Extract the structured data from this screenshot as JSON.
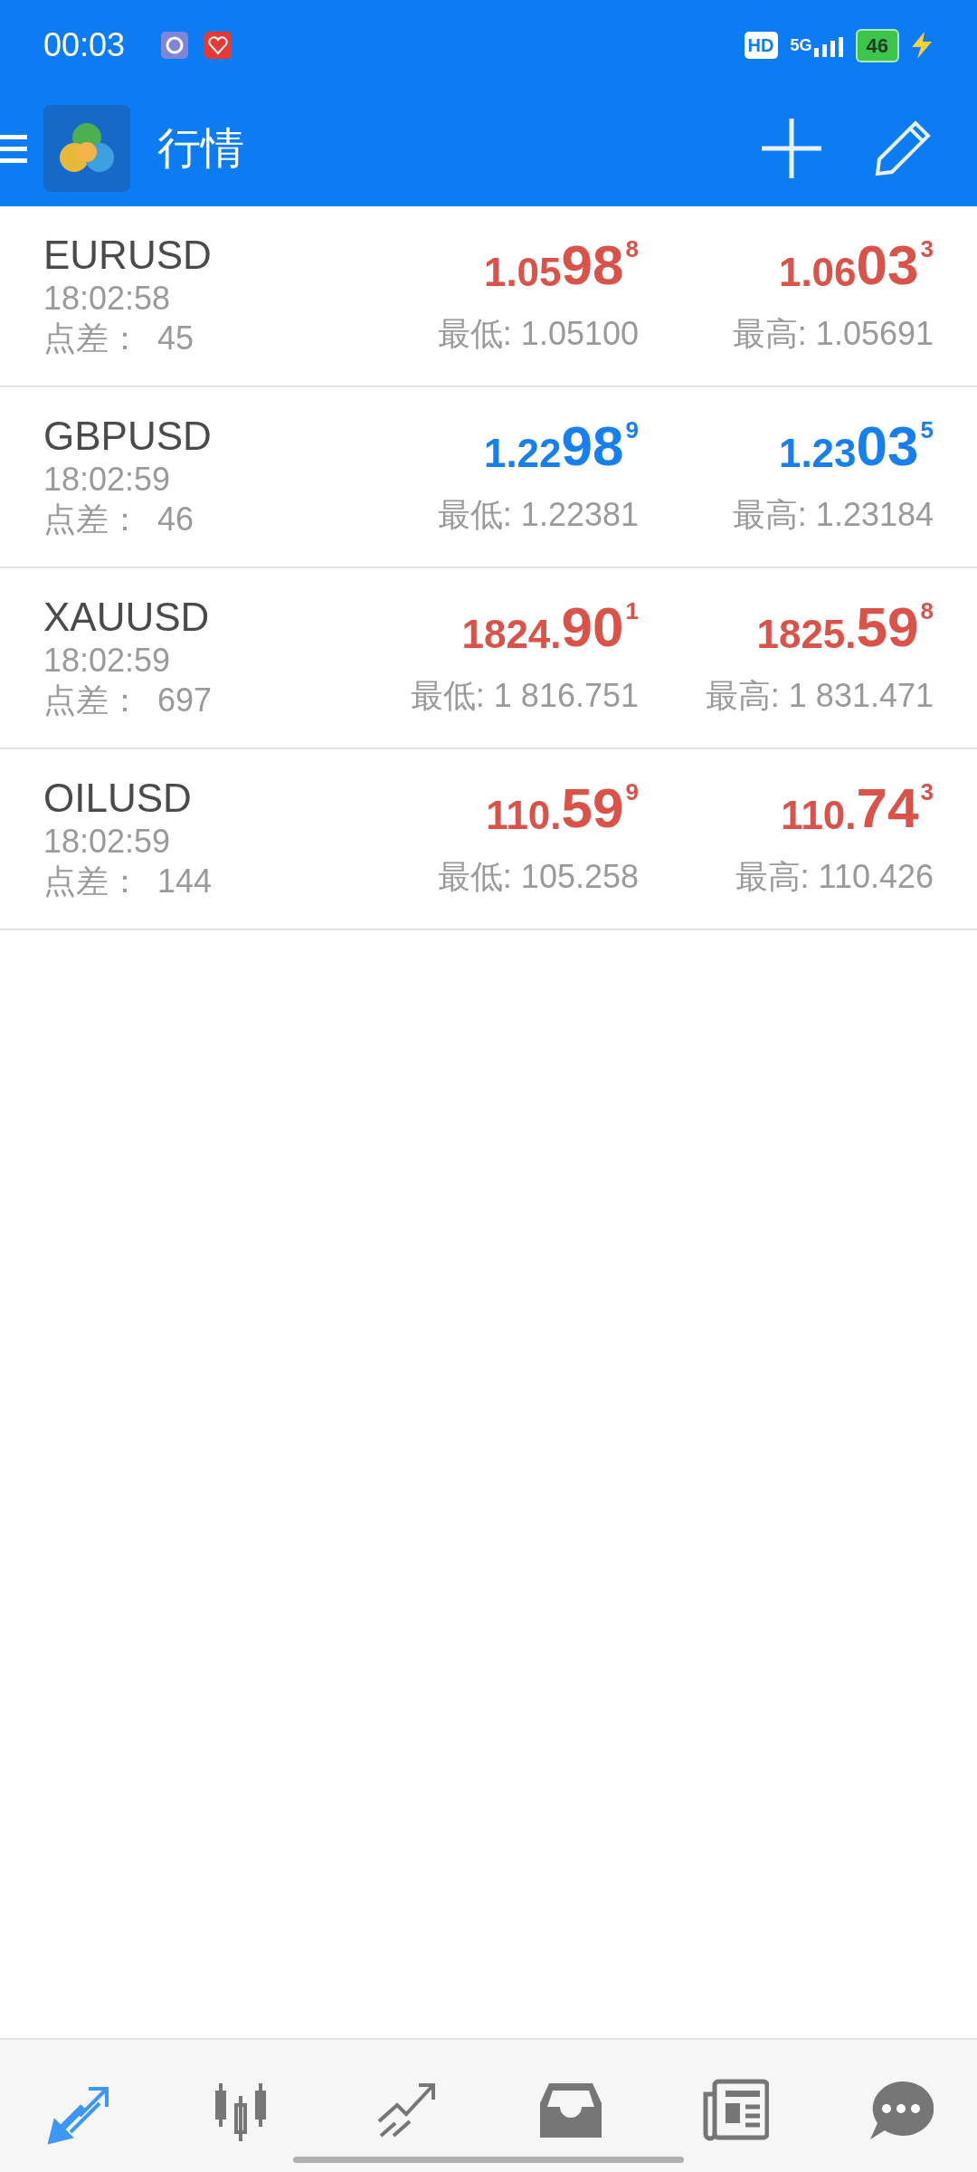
{
  "status_bar": {
    "time": "00:03",
    "hd": "HD",
    "network": "5G",
    "battery": "46"
  },
  "header": {
    "title": "行情"
  },
  "quotes": [
    {
      "symbol": "EURUSD",
      "time": "18:02:58",
      "spread_label": "点差：",
      "spread": "45",
      "bid": {
        "prefix": "1.05",
        "big": "98",
        "sup": "8",
        "color": "#d9534a"
      },
      "ask": {
        "prefix": "1.06",
        "big": "03",
        "sup": "3",
        "color": "#d9534a"
      },
      "low": "最低: 1.05100",
      "high": "最高: 1.05691"
    },
    {
      "symbol": "GBPUSD",
      "time": "18:02:59",
      "spread_label": "点差：",
      "spread": "46",
      "bid": {
        "prefix": "1.22",
        "big": "98",
        "sup": "9",
        "color": "#1780ee"
      },
      "ask": {
        "prefix": "1.23",
        "big": "03",
        "sup": "5",
        "color": "#1780ee"
      },
      "low": "最低: 1.22381",
      "high": "最高: 1.23184"
    },
    {
      "symbol": "XAUUSD",
      "time": "18:02:59",
      "spread_label": "点差：",
      "spread": "697",
      "bid": {
        "prefix": "1824.",
        "big": "90",
        "sup": "1",
        "color": "#d9534a"
      },
      "ask": {
        "prefix": "1825.",
        "big": "59",
        "sup": "8",
        "color": "#d9534a"
      },
      "low": "最低: 1 816.751",
      "high": "最高: 1 831.471"
    },
    {
      "symbol": "OILUSD",
      "time": "18:02:59",
      "spread_label": "点差：",
      "spread": "144",
      "bid": {
        "prefix": "110.",
        "big": "59",
        "sup": "9",
        "color": "#d9534a"
      },
      "ask": {
        "prefix": "110.",
        "big": "74",
        "sup": "3",
        "color": "#d9534a"
      },
      "low": "最低: 105.258",
      "high": "最高: 110.426"
    }
  ],
  "bottom_nav": [
    {
      "kind": "quotes",
      "selected": true
    },
    {
      "kind": "chart",
      "selected": false
    },
    {
      "kind": "trade",
      "selected": false
    },
    {
      "kind": "history",
      "selected": false
    },
    {
      "kind": "news",
      "selected": false
    },
    {
      "kind": "messages",
      "selected": false
    }
  ]
}
